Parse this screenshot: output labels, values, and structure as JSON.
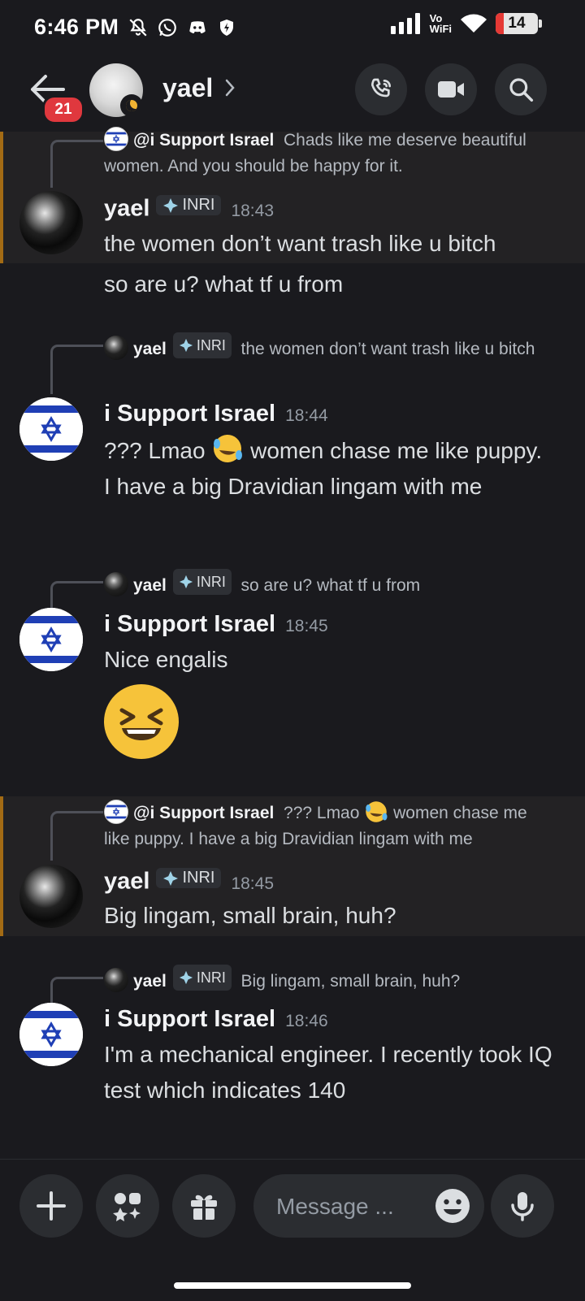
{
  "status": {
    "time": "6:46 PM",
    "network": "Vo\nWiFi",
    "battery": "14"
  },
  "header": {
    "name": "yael",
    "unread_badge": "21"
  },
  "messages": [
    {
      "reply_author": "@i Support Israel",
      "reply_text": "Chads like me deserve beautiful women. And you should be happy for it.",
      "author": "yael",
      "tag": "INRI",
      "time": "18:43",
      "lines": [
        "the women don’t want trash like u bitch",
        "so are u? what tf u from"
      ]
    },
    {
      "reply_author": "yael",
      "reply_tag": "INRI",
      "reply_text": "the women don’t want trash like u bitch",
      "author": "i Support Israel",
      "time": "18:44",
      "text_a": "??? Lmao",
      "text_b": "women chase me like puppy.  I have a big Dravidian lingam with me"
    },
    {
      "reply_author": "yael",
      "reply_tag": "INRI",
      "reply_text": "so are u? what tf u from",
      "author": "i Support Israel",
      "time": "18:45",
      "text": "Nice engalis"
    },
    {
      "reply_author": "@i Support Israel",
      "reply_text_a": "??? Lmao",
      "reply_text_b": "women chase me like puppy.  I have a big Dravidian lingam with me",
      "author": "yael",
      "tag": "INRI",
      "time": "18:45",
      "text": "Big lingam, small brain, huh?"
    },
    {
      "reply_author": "yael",
      "reply_tag": "INRI",
      "reply_text": "Big lingam, small brain, huh?",
      "author": "i Support Israel",
      "time": "18:46",
      "text": "I'm a mechanical engineer. I recently took IQ test which indicates 140"
    }
  ],
  "composer": {
    "placeholder": "Message ..."
  },
  "colors": {
    "background": "#1a1a1e",
    "highlight": "#232224",
    "mention_bar": "#a36b14",
    "badge": "#e0383e"
  },
  "icons": [
    "back-arrow-icon",
    "voice-call-icon",
    "video-call-icon",
    "search-icon",
    "plus-icon",
    "apps-icon",
    "gift-icon",
    "emoji-icon",
    "microphone-icon"
  ]
}
